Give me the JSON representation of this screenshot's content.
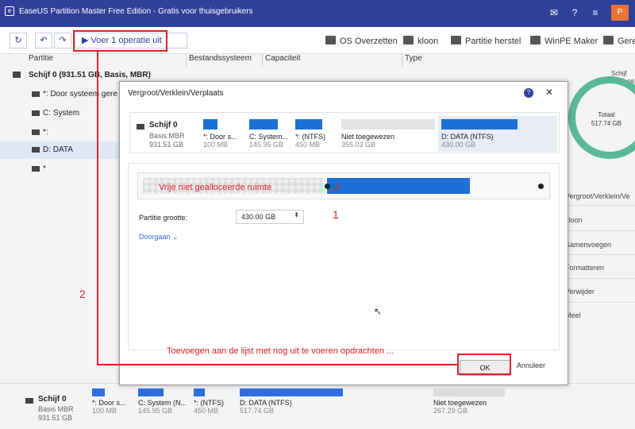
{
  "window": {
    "title": "EaseUS Partition Master Free Edition - Gratis voor thuisgebruikers",
    "user_initial": "P"
  },
  "toolbar": {
    "run_label": "Voer 1 operatie uit",
    "items": [
      "OS Overzetten",
      "kloon",
      "Partitie herstel",
      "WinPE Maker",
      "Gere"
    ]
  },
  "columns": [
    "Partitie",
    "Bestandssysteem",
    "Capaciteit",
    "Type"
  ],
  "sidebar": {
    "disk": "Schijf 0 (931.51 GB, Basis, MBR)",
    "items": [
      "*: Door systeem gere",
      "C: System",
      "*:",
      "D: DATA",
      "*"
    ]
  },
  "right_panel": {
    "top_label": "Schijf",
    "top_value": "28",
    "total_label": "Totaal",
    "total_value": "517.74 GB",
    "ops": [
      "Vergroot/Verklein/Ve",
      "kloon",
      "Samenvoegen",
      "Formatteren",
      "Verwijder",
      "Meel"
    ]
  },
  "bottom": {
    "disk_name": "Schijf 0",
    "disk_type": "Basis MBR",
    "disk_size": "931.51 GB",
    "parts": [
      {
        "name": "*: Door s...",
        "size": "100 MB"
      },
      {
        "name": "C: System (N...",
        "size": "145.95 GB"
      },
      {
        "name": "*: (NTFS)",
        "size": "450 MB"
      },
      {
        "name": "D: DATA (NTFS)",
        "size": "517.74 GB"
      },
      {
        "name": "Niet toegewezen",
        "size": "267.29 GB"
      }
    ]
  },
  "dialog": {
    "title": "Vergroot/Verklein/Verplaats",
    "disk_name": "Schijf 0",
    "disk_type": "Basis MBR",
    "disk_size": "931.51 GB",
    "parts": [
      {
        "name": "*: Door s...",
        "size": "100 MB"
      },
      {
        "name": "C: System...",
        "size": "145.95 GB"
      },
      {
        "name": "*: (NTFS)",
        "size": "450 MB"
      },
      {
        "name": "Niet toegewezen",
        "size": "355.03 GB"
      },
      {
        "name": "D: DATA (NTFS)",
        "size": "430.00 GB"
      }
    ],
    "size_label": "Partitie grootte:",
    "size_value": "430.00 GB",
    "more_link": "Doorgaan",
    "ok_label": "OK",
    "cancel_label": "Annuleer"
  },
  "annotations": {
    "free_space": "Vrije niet gealloceerde ruimte",
    "step1": "1",
    "step2": "2",
    "instruction": "Toevoegen aan de lijst met nog uit te voeren opdrachten ..."
  },
  "colors": {
    "accent": "#2f3f9a",
    "partition_blue": "#1e6fd6",
    "annotation_red": "#d8262b",
    "donut_green": "#5ab896"
  }
}
